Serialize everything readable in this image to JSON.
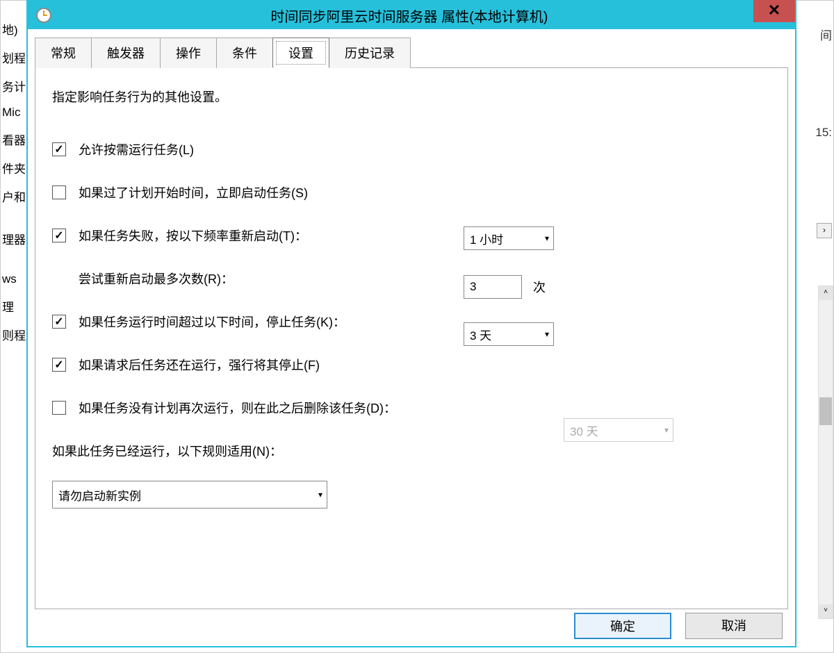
{
  "background": {
    "left_items": [
      "地)",
      "划程",
      "务计",
      "Mic",
      "看器",
      "件夹",
      "户和",
      "理器",
      "ws",
      "理",
      "则程序"
    ],
    "right_text_1": "间",
    "right_text_2": "15:"
  },
  "dialog": {
    "title": "时间同步阿里云时间服务器 属性(本地计算机)",
    "close_icon": "✕",
    "tabs": {
      "general": "常规",
      "triggers": "触发器",
      "actions": "操作",
      "conditions": "条件",
      "settings": "设置",
      "history": "历史记录"
    },
    "content": {
      "description": "指定影响任务行为的其他设置。",
      "allow_on_demand": {
        "checked": true,
        "label": "允许按需运行任务(L)"
      },
      "start_when_missed": {
        "checked": false,
        "label": "如果过了计划开始时间，立即启动任务(S)"
      },
      "restart_on_fail": {
        "checked": true,
        "label": "如果任务失败，按以下频率重新启动(T)：",
        "interval": "1 小时"
      },
      "restart_attempts": {
        "label": "尝试重新启动最多次数(R)：",
        "value": "3",
        "suffix": "次"
      },
      "stop_if_long": {
        "checked": true,
        "label": "如果任务运行时间超过以下时间，停止任务(K)：",
        "duration": "3 天"
      },
      "force_stop": {
        "checked": true,
        "label": "如果请求后任务还在运行，强行将其停止(F)"
      },
      "delete_if_not_scheduled": {
        "checked": false,
        "label": "如果任务没有计划再次运行，则在此之后删除该任务(D)：",
        "duration": "30 天"
      },
      "rule_label": "如果此任务已经运行，以下规则适用(N)：",
      "rule_value": "请勿启动新实例"
    },
    "buttons": {
      "ok": "确定",
      "cancel": "取消"
    }
  }
}
